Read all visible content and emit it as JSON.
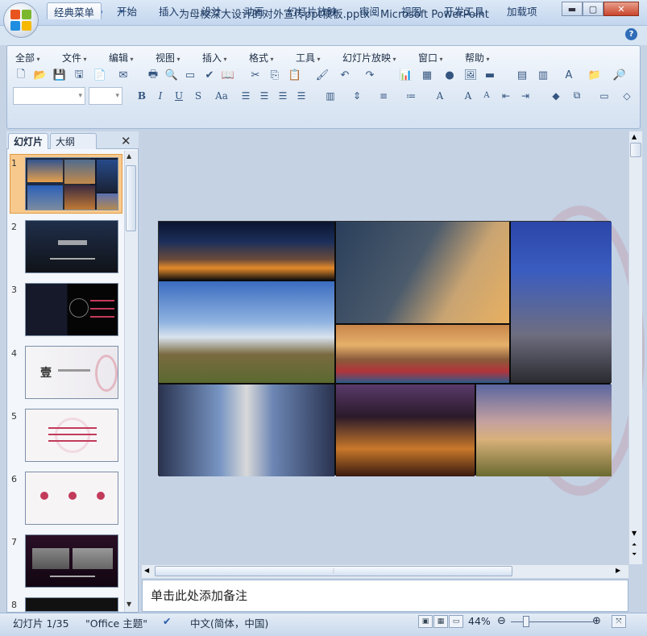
{
  "window": {
    "title": "为母校深大设计的对外宣传ppt模板.pptx - Microsoft PowerPoint"
  },
  "ribbon_tabs": [
    {
      "label": "经典菜单",
      "active": true
    },
    {
      "label": "开始"
    },
    {
      "label": "插入"
    },
    {
      "label": "设计"
    },
    {
      "label": "动画"
    },
    {
      "label": "幻灯片放映"
    },
    {
      "label": "审阅"
    },
    {
      "label": "视图"
    },
    {
      "label": "开发工具"
    },
    {
      "label": "加载项"
    }
  ],
  "menus": [
    "全部",
    "文件",
    "编辑",
    "视图",
    "插入",
    "格式",
    "工具",
    "幻灯片放映",
    "窗口",
    "帮助"
  ],
  "pane_tabs": {
    "slides": "幻灯片",
    "outline": "大纲"
  },
  "thumbnails": [
    "1",
    "2",
    "3",
    "4",
    "5",
    "6",
    "7",
    "8"
  ],
  "thumb4_char": "壹",
  "notes_placeholder": "单击此处添加备注",
  "status": {
    "slide": "幻灯片 1/35",
    "theme": "\"Office 主题\"",
    "language": "中文(简体，中国)",
    "zoom": "44%"
  },
  "colors": {
    "accent_orange": "#f4a14c",
    "ribbon_blue": "#d7e4f2"
  }
}
